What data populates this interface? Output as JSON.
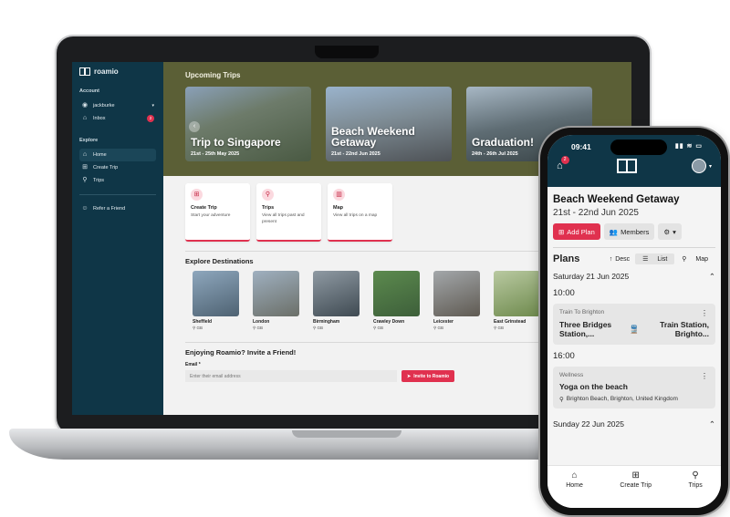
{
  "laptop": {
    "brand": "roamio",
    "sidebar": {
      "account_heading": "Account",
      "user": "jackburke",
      "inbox_label": "Inbox",
      "inbox_count": "2",
      "explore_heading": "Explore",
      "items": [
        {
          "label": "Home",
          "icon": "home-icon"
        },
        {
          "label": "Create Trip",
          "icon": "plus-square-icon"
        },
        {
          "label": "Trips",
          "icon": "pin-icon"
        }
      ],
      "refer_label": "Refer a Friend"
    },
    "upcoming": {
      "heading": "Upcoming Trips",
      "cards": [
        {
          "title": "Trip to Singapore",
          "dates": "21st - 25th May 2025"
        },
        {
          "title": "Beach Weekend Getaway",
          "dates": "21st - 22nd Jun 2025"
        },
        {
          "title": "Graduation!",
          "dates": "24th - 26th Jul 2025"
        }
      ]
    },
    "quick_actions": [
      {
        "title": "Create Trip",
        "desc": "Start your adventure"
      },
      {
        "title": "Trips",
        "desc": "View all trips past and present"
      },
      {
        "title": "Map",
        "desc": "View all trips on a map"
      }
    ],
    "explore": {
      "heading": "Explore Destinations",
      "destinations": [
        {
          "name": "Sheffield",
          "country": "GB"
        },
        {
          "name": "London",
          "country": "GB"
        },
        {
          "name": "Birmingham",
          "country": "GB"
        },
        {
          "name": "Crawley Down",
          "country": "GB"
        },
        {
          "name": "Leicester",
          "country": "GB"
        },
        {
          "name": "East Grinstead",
          "country": "GB"
        }
      ]
    },
    "invite": {
      "heading": "Enjoying Roamio? Invite a Friend!",
      "email_label": "Email *",
      "email_placeholder": "Enter their email address",
      "button": "Invite to Roamio"
    }
  },
  "phone": {
    "status_time": "09:41",
    "notification_count": "2",
    "trip_title": "Beach Weekend Getaway",
    "trip_dates": "21st - 22nd Jun 2025",
    "add_plan": "Add Plan",
    "members": "Members",
    "plans_heading": "Plans",
    "sort_label": "Desc",
    "view_list": "List",
    "view_map": "Map",
    "day1": "Saturday 21 Jun 2025",
    "time1": "10:00",
    "plan1": {
      "category": "Train To Brighton",
      "from": "Three Bridges Station,...",
      "to": "Train Station, Brighto..."
    },
    "time2": "16:00",
    "plan2": {
      "category": "Wellness",
      "name": "Yoga on the beach",
      "location": "Brighton Beach, Brighton, United Kingdom"
    },
    "day2": "Sunday 22 Jun 2025",
    "tabs": [
      "Home",
      "Create Trip",
      "Trips"
    ]
  }
}
